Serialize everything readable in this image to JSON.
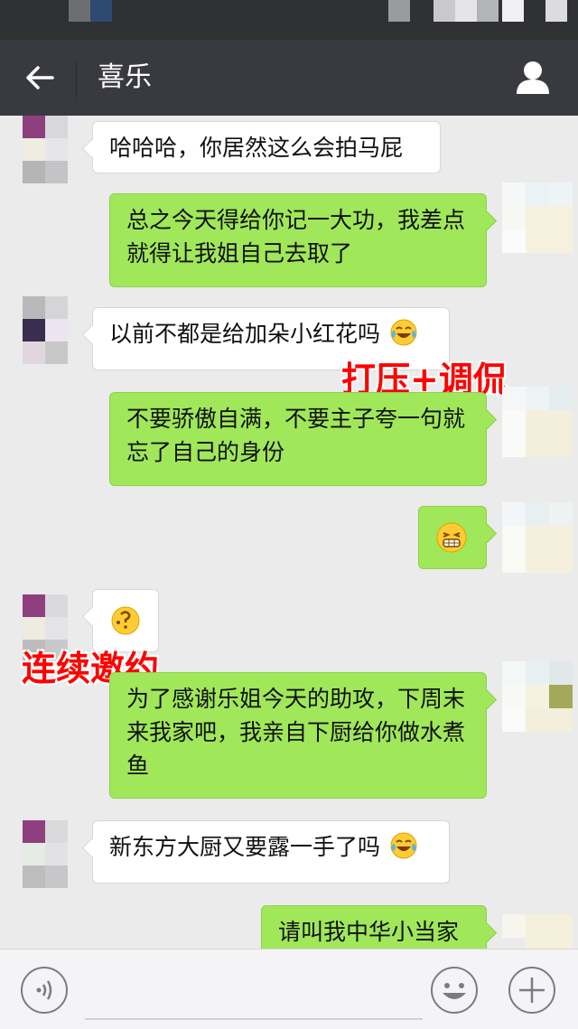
{
  "header": {
    "title": "喜乐",
    "back_icon": "arrow-left-icon",
    "profile_icon": "person-icon"
  },
  "messages": [
    {
      "side": "in",
      "text": "哈哈哈，你居然这么会拍马屁"
    },
    {
      "side": "out",
      "text": "总之今天得给你记一大功，我差点就得让我姐自己去取了"
    },
    {
      "side": "in",
      "text": "以前不都是给加朵小红花吗",
      "emoji": "tears-of-joy-emoji"
    },
    {
      "side": "out",
      "text": "不要骄傲自满，不要主子夸一句就忘了自己的身份"
    },
    {
      "side": "out",
      "emoji": "grin-emoji"
    },
    {
      "side": "in",
      "emoji": "thinking-emoji"
    },
    {
      "side": "out",
      "text": "为了感谢乐姐今天的助攻，下周末来我家吧，我亲自下厨给你做水煮鱼"
    },
    {
      "side": "in",
      "text": "新东方大厨又要露一手了吗",
      "emoji": "tears-of-joy-emoji"
    },
    {
      "side": "out",
      "text": "请叫我中华小当家"
    }
  ],
  "annotations": {
    "first": "打压+调侃",
    "second": "连续邀约"
  },
  "input_bar": {
    "voice_icon": "voice-icon",
    "text_value": "",
    "emoji_icon": "smiley-icon",
    "more_icon": "plus-icon"
  },
  "colors": {
    "navbar": "#393a3f",
    "outgoing_bubble": "#a0e75a",
    "incoming_bubble": "#ffffff",
    "background": "#ebebeb",
    "annotation": "#ff0000"
  }
}
